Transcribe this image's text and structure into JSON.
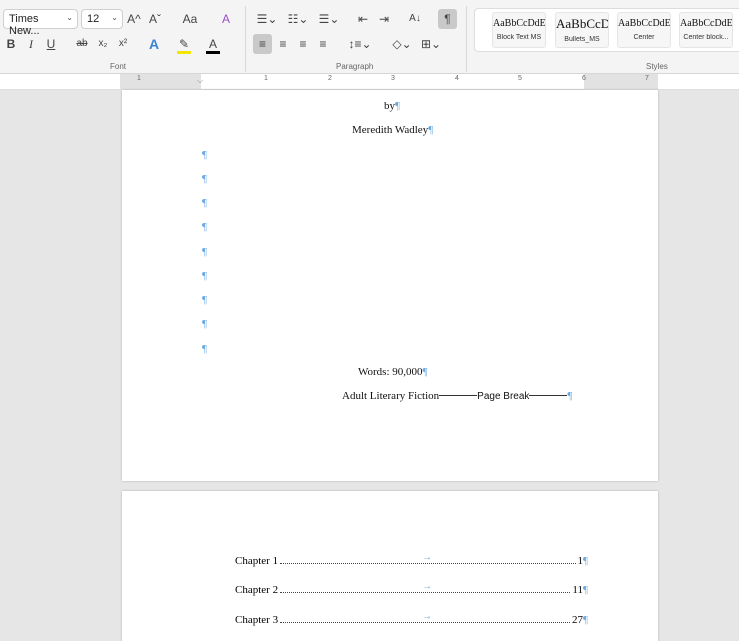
{
  "ribbon": {
    "font": {
      "name": "Times New...",
      "size": "12",
      "grow": "A^",
      "shrink": "Aˇ",
      "case": "Aa",
      "clear": "A",
      "bold": "B",
      "italic": "I",
      "underline": "U",
      "strike": "ab",
      "subscript": "x₂",
      "superscript": "x²",
      "effects": "A",
      "highlight": "✎",
      "color": "A",
      "label": "Font"
    },
    "paragraph": {
      "sort": "A↓",
      "show_marks": "¶",
      "label": "Paragraph"
    },
    "styles": {
      "label": "Styles",
      "items": [
        {
          "preview": "AaBbCcDdEe",
          "name": "Block Text MS"
        },
        {
          "preview": "AaBbCcD",
          "name": "Bullets_MS"
        },
        {
          "preview": "AaBbCcDdEe",
          "name": "Center"
        },
        {
          "preview": "AaBbCcDdEe",
          "name": "Center block..."
        }
      ]
    }
  },
  "ruler": {
    "numbers": [
      "1",
      "1",
      "2",
      "3",
      "4",
      "5",
      "6",
      "7"
    ]
  },
  "page1": {
    "by": "by",
    "author": "Meredith Wadley",
    "words": "Words: 90,000",
    "genre": "Adult Literary Fiction",
    "page_break": "Page Break",
    "mark": "¶"
  },
  "page2": {
    "toc": [
      {
        "label": "Chapter 1",
        "page": "1"
      },
      {
        "label": "Chapter 2",
        "page": "11"
      },
      {
        "label": "Chapter 3",
        "page": "27"
      }
    ],
    "tab": "→"
  },
  "colors": {
    "accent": "#6aa8e0"
  }
}
